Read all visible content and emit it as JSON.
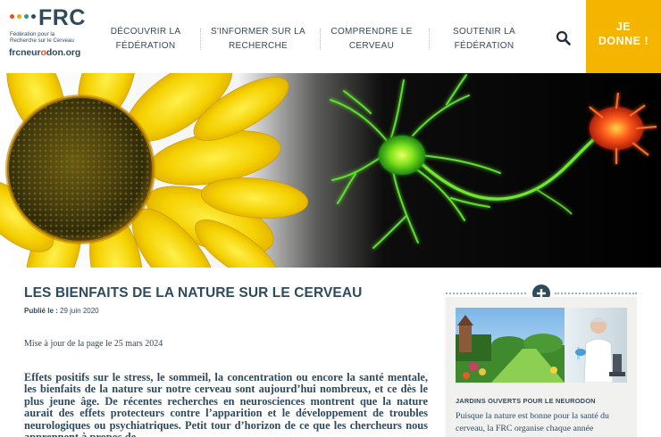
{
  "header": {
    "logo": {
      "mark": "FRC",
      "subtitle_line1": "Fédération pour la",
      "subtitle_line2": "Recherche sur le Cerveau",
      "url_part1": "frcneur",
      "url_part2": "o",
      "url_part3": "don.org",
      "dot_colors": [
        "#e94e1b",
        "#f5a800",
        "#2a9d8f",
        "#2e4a5e"
      ]
    },
    "nav": [
      {
        "line1": "Découvrir la",
        "line2": "Fédération"
      },
      {
        "line1": "S'informer sur la",
        "line2": "recherche"
      },
      {
        "line1": "Comprendre le",
        "line2": "cerveau"
      },
      {
        "line1": "Soutenir la",
        "line2": "Fédération"
      }
    ],
    "search_icon": "search-icon",
    "donate": {
      "line1": "JE",
      "line2": "DONNE !"
    }
  },
  "article": {
    "title": "LES BIENFAITS DE LA NATURE SUR LE CERVEAU",
    "published_label": "Publié le :",
    "published_date": "29 juin 2020",
    "updated": "Mise à jour de la page le 25 mars 2024",
    "lead": "Effets positifs sur le stress, le sommeil, la concentration ou encore la santé mentale, les bienfaits de la nature sur notre cerveau sont aujourd’hui nombreux, et ce dès le plus jeune âge. De récentes recherches en neurosciences montrent que la nature aurait des effets protecteurs contre l’apparition et le développement de troubles neurologiques ou psychiatriques. Petit tour d’horizon de ce que les chercheurs nous apprennent à propos de"
  },
  "sidebar": {
    "expand_icon": "plus-icon",
    "card": {
      "title": "JARDINS OUVERTS POUR LE NEURODON",
      "text": "Puisque la nature est bonne pour la santé du cerveau, la FRC organise chaque année"
    }
  },
  "colors": {
    "primary": "#2e4a5e",
    "accent_yellow": "#f5b400",
    "accent_orange": "#e94e1b",
    "card_bg": "#f1f1f0"
  }
}
